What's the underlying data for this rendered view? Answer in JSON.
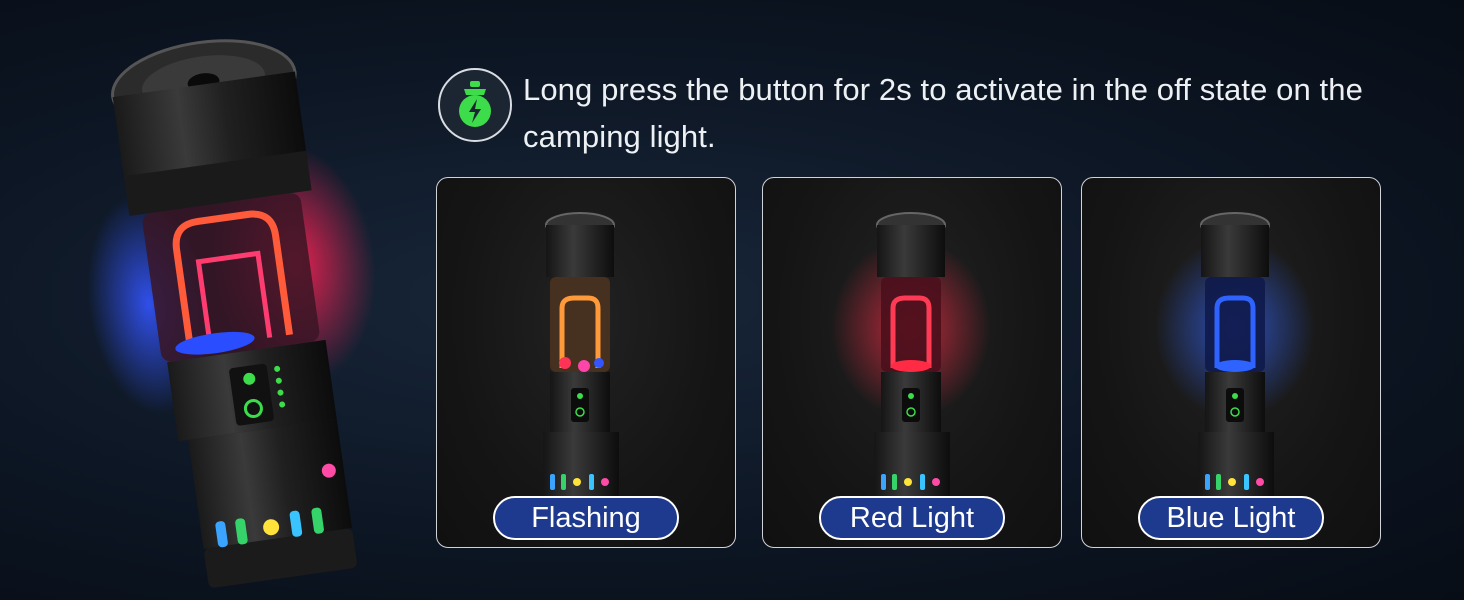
{
  "instruction": {
    "icon": "lightbulb-lightning-icon",
    "text": "Long press the button for 2s to activate in the off state on the camping light."
  },
  "modes": [
    {
      "label": "Flashing",
      "glow": "multicolor"
    },
    {
      "label": "Red Light",
      "glow": "#ff2a44"
    },
    {
      "label": "Blue Light",
      "glow": "#2f63ff"
    }
  ],
  "colors": {
    "background": "#0d1624",
    "pill": "#1e3a8e",
    "accent_green": "#3ddc4a",
    "red_glow": "#ff2a44",
    "blue_glow": "#2f63ff"
  }
}
